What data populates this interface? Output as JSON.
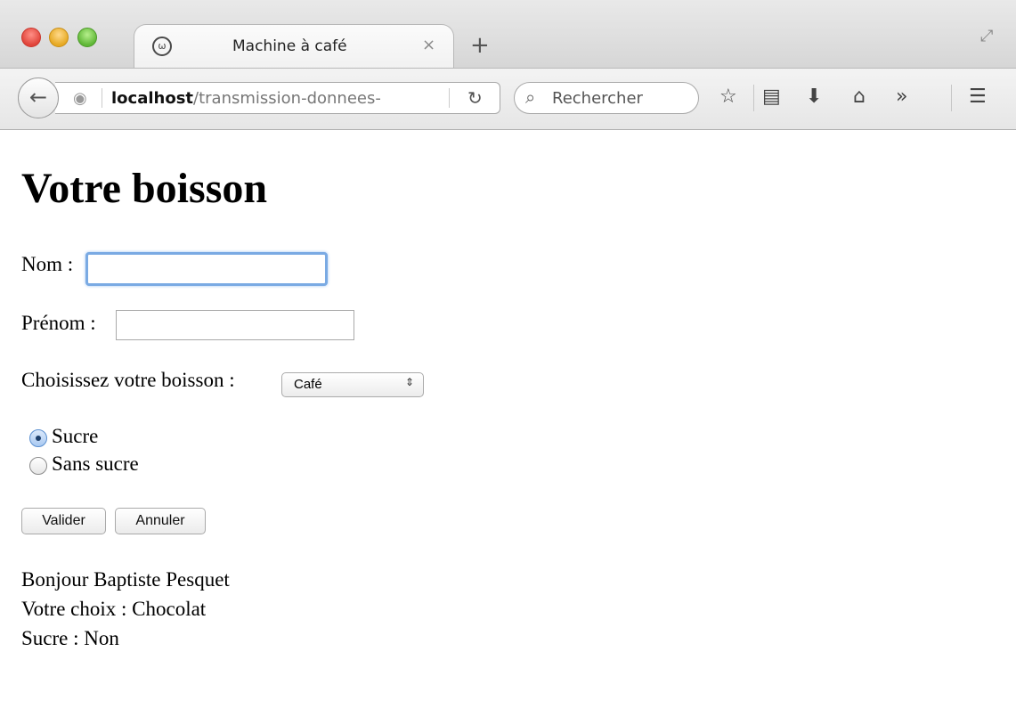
{
  "browser": {
    "tab_title": "Machine à café",
    "tab_close": "×",
    "new_tab": "+",
    "url_host": "localhost",
    "url_path": "/transmission-donnees-",
    "search_placeholder": "Rechercher",
    "icons": [
      "back-arrow-icon",
      "globe-icon",
      "reload-icon",
      "search-icon",
      "star-icon",
      "reading-list-icon",
      "download-icon",
      "home-icon",
      "overflow-icon",
      "menu-icon"
    ]
  },
  "page": {
    "heading": "Votre boisson",
    "nom_label": "Nom :",
    "nom_value": "",
    "prenom_label": "Prénom :",
    "prenom_value": "",
    "boisson_label": "Choisissez votre boisson :",
    "boisson_selected": "Café",
    "radio_sucre": "Sucre",
    "radio_sans_sucre": "Sans sucre",
    "radio_checked": "Sucre",
    "valider": "Valider",
    "annuler": "Annuler",
    "result_greeting": "Bonjour Baptiste Pesquet",
    "result_choice": "Votre choix : Chocolat",
    "result_sugar": "Sucre : Non"
  }
}
